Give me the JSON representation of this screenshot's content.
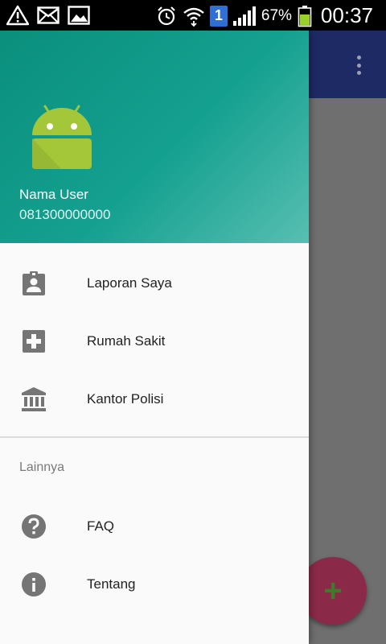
{
  "status_bar": {
    "left_icons": [
      "warning-icon",
      "mail-icon",
      "image-icon"
    ],
    "right_icons": [
      "alarm-icon",
      "wifi-icon",
      "sim-badge-icon",
      "signal-icon",
      "battery-icon"
    ],
    "sim_badge": "1",
    "battery_percent": "67%",
    "time": "00:37"
  },
  "drawer": {
    "header": {
      "avatar_icon": "android-icon",
      "user_name": "Nama User",
      "user_phone": "081300000000"
    },
    "items": [
      {
        "label": "Laporan Saya",
        "icon": "assignment-ind-icon"
      },
      {
        "label": "Rumah Sakit",
        "icon": "local-hospital-icon"
      },
      {
        "label": "Kantor Polisi",
        "icon": "account-balance-icon"
      }
    ],
    "section_title": "Lainnya",
    "other_items": [
      {
        "label": "FAQ",
        "icon": "help-icon"
      },
      {
        "label": "Tentang",
        "icon": "info-icon"
      }
    ]
  },
  "background": {
    "toolbar_color": "#1d2a63",
    "fab_icon": "plus-icon",
    "fab_symbol": "+",
    "fab_color": "#8a2a48"
  },
  "colors": {
    "header_start": "#0b8f7d",
    "header_end": "#57bfb2",
    "icon_gray": "#757575"
  }
}
